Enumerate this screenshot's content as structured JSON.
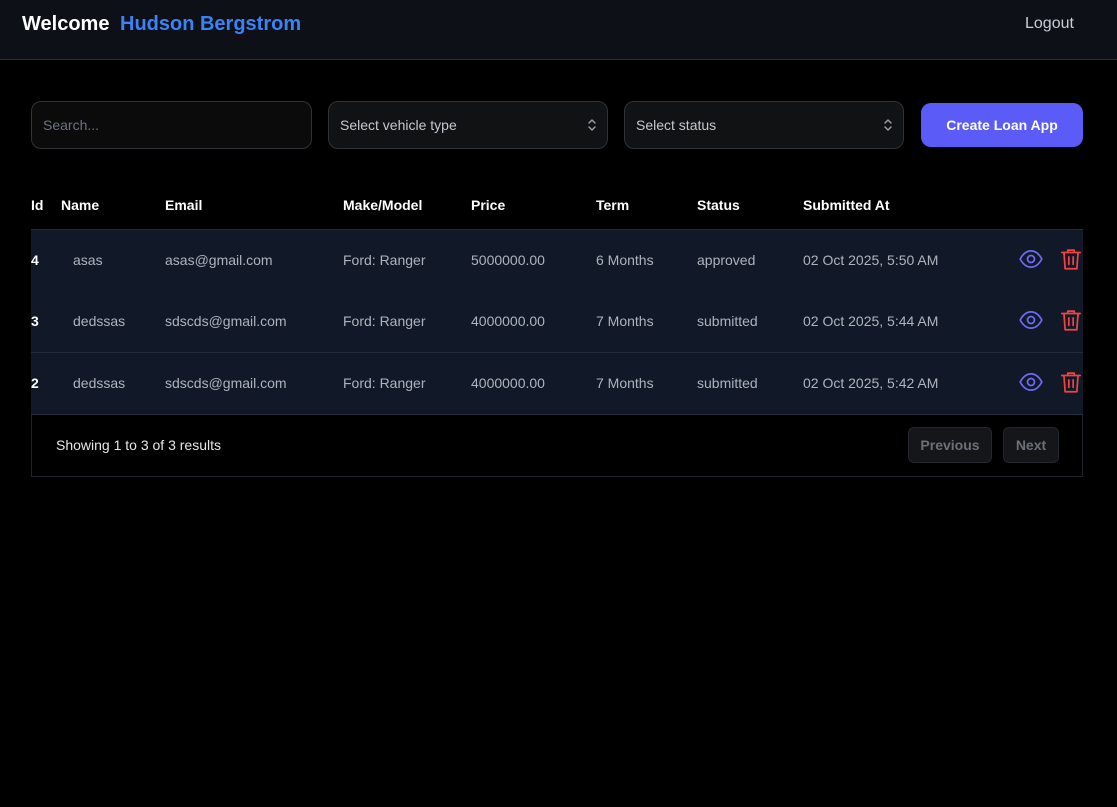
{
  "header": {
    "welcome_label": "Welcome",
    "user_name": "Hudson Bergstrom",
    "logout_label": "Logout",
    "accent_color": "#3b82f6"
  },
  "filters": {
    "search_placeholder": "Search...",
    "search_value": "",
    "vehicle_type_label": "Select vehicle type",
    "status_label": "Select status",
    "create_button_label": "Create Loan App",
    "create_button_color": "#5b5bf7"
  },
  "table": {
    "columns": [
      "Id",
      "Name",
      "Email",
      "Make/Model",
      "Price",
      "Term",
      "Status",
      "Submitted At"
    ],
    "rows": [
      {
        "id": "4",
        "name": "asas",
        "email": "asas@gmail.com",
        "make_model": "Ford: Ranger",
        "price": "5000000.00",
        "term": "6 Months",
        "status": "approved",
        "submitted_at": "02 Oct 2025, 5:50 AM"
      },
      {
        "id": "3",
        "name": "dedssas",
        "email": "sdscds@gmail.com",
        "make_model": "Ford: Ranger",
        "price": "4000000.00",
        "term": "7 Months",
        "status": "submitted",
        "submitted_at": "02 Oct 2025, 5:44 AM"
      },
      {
        "id": "2",
        "name": "dedssas",
        "email": "sdscds@gmail.com",
        "make_model": "Ford: Ranger",
        "price": "4000000.00",
        "term": "7 Months",
        "status": "submitted",
        "submitted_at": "02 Oct 2025, 5:42 AM"
      }
    ],
    "row_actions": [
      "eye-icon",
      "trash-icon"
    ],
    "view_icon_color": "#6d6af5",
    "delete_icon_color": "#ef4444"
  },
  "pagination": {
    "summary": "Showing 1 to 3 of 3 results",
    "previous_label": "Previous",
    "next_label": "Next"
  }
}
